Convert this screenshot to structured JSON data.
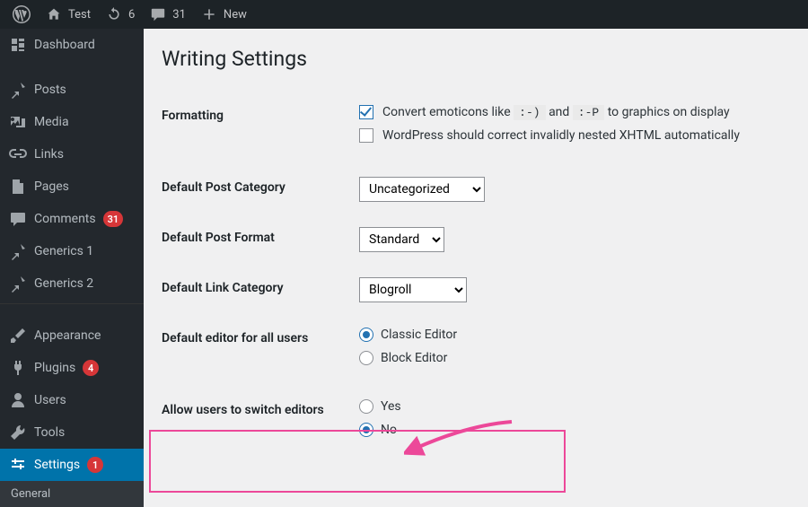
{
  "adminbar": {
    "site_name": "Test",
    "updates_count": "6",
    "comments_count": "31",
    "new_label": "New"
  },
  "sidebar": {
    "items": [
      {
        "name": "dashboard",
        "label": "Dashboard",
        "icon": "dashboard"
      },
      {
        "name": "posts",
        "label": "Posts",
        "icon": "pin"
      },
      {
        "name": "media",
        "label": "Media",
        "icon": "media"
      },
      {
        "name": "links",
        "label": "Links",
        "icon": "link"
      },
      {
        "name": "pages",
        "label": "Pages",
        "icon": "page"
      },
      {
        "name": "comments",
        "label": "Comments",
        "icon": "comment",
        "badge": "31"
      },
      {
        "name": "generics1",
        "label": "Generics 1",
        "icon": "pin"
      },
      {
        "name": "generics2",
        "label": "Generics 2",
        "icon": "pin"
      },
      {
        "name": "appearance",
        "label": "Appearance",
        "icon": "brush"
      },
      {
        "name": "plugins",
        "label": "Plugins",
        "icon": "plug",
        "badge": "4"
      },
      {
        "name": "users",
        "label": "Users",
        "icon": "user"
      },
      {
        "name": "tools",
        "label": "Tools",
        "icon": "wrench"
      },
      {
        "name": "settings",
        "label": "Settings",
        "icon": "sliders",
        "badge": "1",
        "current": true
      }
    ],
    "submenu": [
      {
        "name": "general",
        "label": "General"
      }
    ]
  },
  "page": {
    "title": "Writing Settings",
    "rows": {
      "formatting": {
        "label": "Formatting",
        "emoticons_pre": "Convert emoticons like",
        "emoticon_a": ":-)",
        "emoticons_and": "and",
        "emoticon_b": ":-P",
        "emoticons_post": "to graphics on display",
        "xhtml": "WordPress should correct invalidly nested XHTML automatically"
      },
      "category": {
        "label": "Default Post Category",
        "value": "Uncategorized"
      },
      "format": {
        "label": "Default Post Format",
        "value": "Standard"
      },
      "link_cat": {
        "label": "Default Link Category",
        "value": "Blogroll"
      },
      "editor": {
        "label": "Default editor for all users",
        "opt_classic": "Classic Editor",
        "opt_block": "Block Editor"
      },
      "switch": {
        "label": "Allow users to switch editors",
        "opt_yes": "Yes",
        "opt_no": "No"
      }
    }
  }
}
